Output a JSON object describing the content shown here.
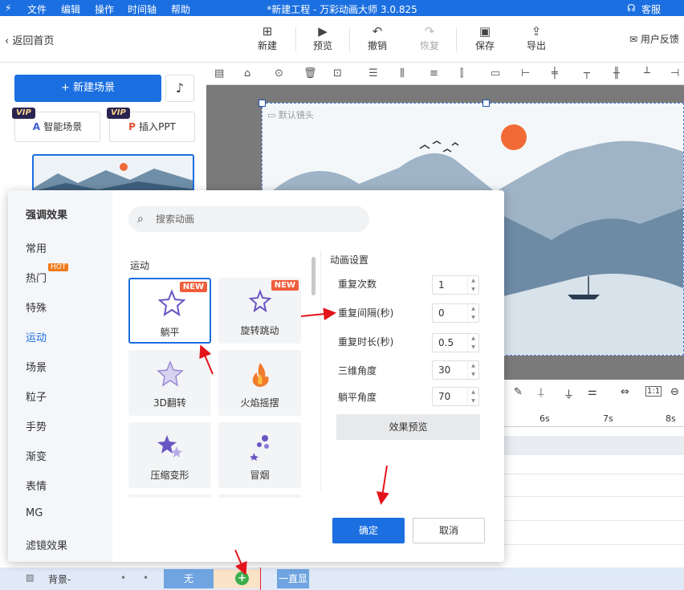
{
  "menu": {
    "file": "文件",
    "edit": "编辑",
    "operate": "操作",
    "timeline": "时间轴",
    "help": "帮助",
    "title": "*新建工程 - 万彩动画大师 3.0.825",
    "service": "客服"
  },
  "toolbar": {
    "back": "返回首页",
    "new": "新建",
    "preview": "预览",
    "undo": "撤销",
    "redo": "恢复",
    "save": "保存",
    "export": "导出",
    "feedback": "用户反馈"
  },
  "left": {
    "new_scene": "新建场景",
    "vip": "VIP",
    "smart_scene": "智能场景",
    "insert_ppt": "插入PPT"
  },
  "stage": {
    "camera": "默认镜头"
  },
  "dialog": {
    "categories_title": "强调效果",
    "categories": [
      "常用",
      "热门",
      "特殊",
      "运动",
      "场景",
      "粒子",
      "手势",
      "渐变",
      "表情",
      "MG",
      "滤镜效果"
    ],
    "hot_badge": "HOT",
    "search_placeholder": "搜索动画",
    "section": "运动",
    "cards": [
      {
        "label": "躺平",
        "badge": "NEW"
      },
      {
        "label": "旋转跳动",
        "badge": "NEW"
      },
      {
        "label": "3D翻转"
      },
      {
        "label": "火焰摇摆"
      },
      {
        "label": "压缩变形"
      },
      {
        "label": "冒烟"
      }
    ],
    "settings_title": "动画设置",
    "settings": [
      {
        "label": "重复次数",
        "value": "1"
      },
      {
        "label": "重复间隔(秒)",
        "value": "0"
      },
      {
        "label": "重复时长(秒)",
        "value": "0.5"
      },
      {
        "label": "三维角度",
        "value": "30"
      },
      {
        "label": "躺平角度",
        "value": "70"
      }
    ],
    "preview_btn": "效果预览",
    "ok": "确定",
    "cancel": "取消"
  },
  "timeline": {
    "ticks": [
      "6s",
      "7s",
      "8s"
    ],
    "ratio": "1:1"
  },
  "bottom": {
    "layer": "背景-",
    "none": "无",
    "always": "一直显"
  },
  "colors": {
    "accent": "#1b6fe0",
    "new_badge": "#f05d3b",
    "hot_badge": "#f07a18"
  }
}
